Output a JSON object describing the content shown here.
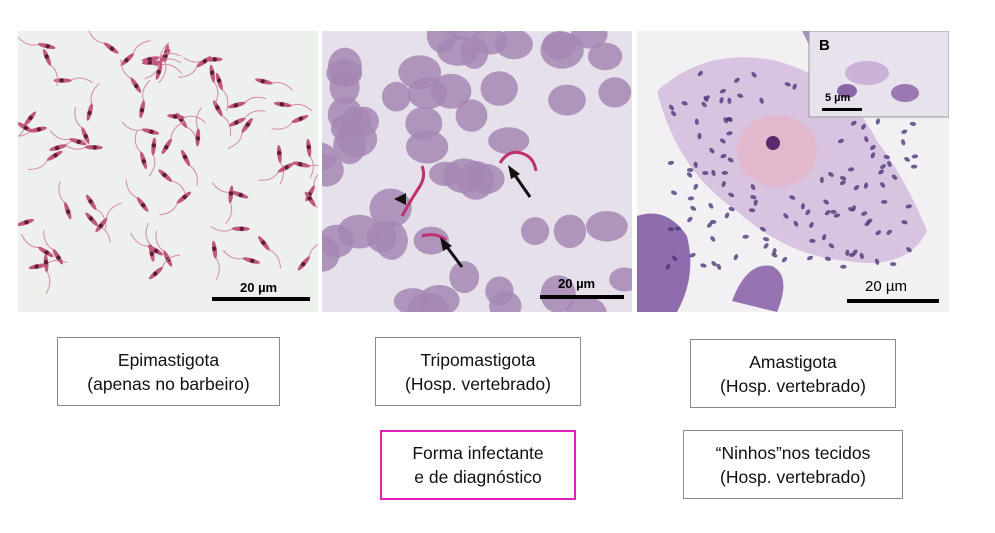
{
  "panels": {
    "epimastigota": {
      "scale": "20 µm"
    },
    "tripomastigota": {
      "scale": "20 µm"
    },
    "amastigota": {
      "scale": "20 µm",
      "inset_letter": "B",
      "inset_scale": "5 µm"
    }
  },
  "labels": {
    "epi": {
      "line1": "Epimastigota",
      "line2": "(apenas no barbeiro)"
    },
    "tripo": {
      "line1": "Tripomastigota",
      "line2": "(Hosp. vertebrado)"
    },
    "ama": {
      "line1": "Amastigota",
      "line2": "(Hosp. vertebrado)"
    },
    "infectante": {
      "line1": "Forma infectante",
      "line2": "e de diagnóstico"
    },
    "ninhos": {
      "line1": "“Ninhos”nos tecidos",
      "line2": "(Hosp. vertebrado)"
    }
  },
  "colors": {
    "highlight_border": "#e020b8",
    "stain_pink": "#c05a8a",
    "stain_purple": "#8e6aa8"
  }
}
